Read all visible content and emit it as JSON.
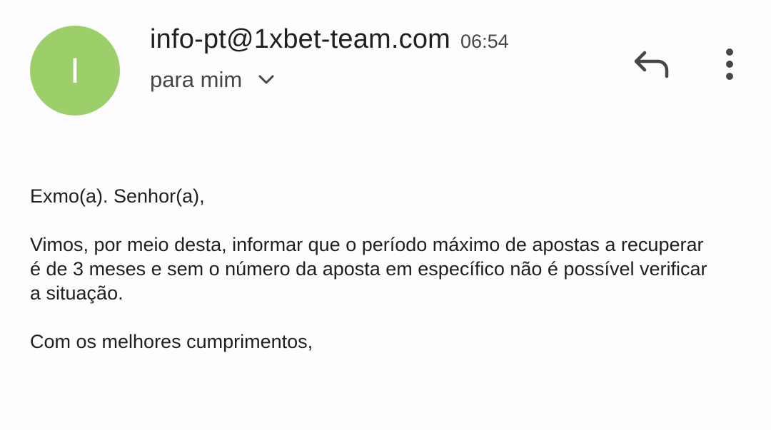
{
  "colors": {
    "avatar_bg": "#9ccf69",
    "icon_color": "#444746"
  },
  "header": {
    "avatar_initial": "I",
    "sender": "info-pt@1xbet-team.com",
    "time": "06:54",
    "recipient": "para mim",
    "recipient_toggle_icon": "chevron-down-icon",
    "reply_icon": "reply-icon",
    "more_icon": "more-vert-icon"
  },
  "message": {
    "greeting": "Exmo(a). Senhor(a),",
    "paragraph": "Vimos, por meio desta, informar que o período máximo de apostas a recuperar é de 3 meses e sem o número da aposta em específico não é possível verificar a situação.",
    "closing": "Com os melhores cumprimentos,"
  }
}
